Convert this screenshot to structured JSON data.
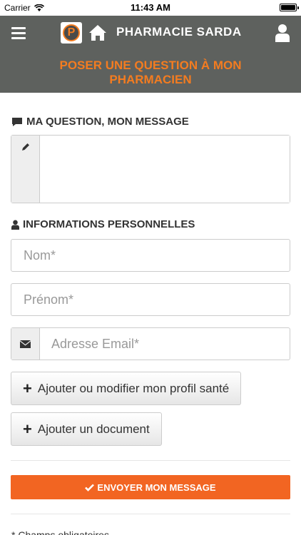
{
  "status_bar": {
    "carrier": "Carrier",
    "time": "11:43 AM",
    "battery_level": 1.0
  },
  "header": {
    "logo_letter": "P",
    "title": "PHARMACIE SARDA",
    "subtitle_line1": "POSER UNE QUESTION À MON",
    "subtitle_line2": "PHARMACIEN"
  },
  "message_section": {
    "title": "MA QUESTION, MON MESSAGE",
    "icon": "comment-icon",
    "edit_icon": "pencil-icon",
    "value": ""
  },
  "personal_section": {
    "title": "INFORMATIONS PERSONNELLES",
    "icon": "user-icon",
    "nom_placeholder": "Nom*",
    "prenom_placeholder": "Prénom*",
    "email_placeholder": "Adresse Email*",
    "email_icon": "envelope-icon"
  },
  "actions": {
    "profile_button": "Ajouter ou modifier mon profil santé",
    "document_button": "Ajouter un document",
    "send_button": "ENVOYER MON MESSAGE"
  },
  "footer": {
    "partial_text": "* Champs obligatoires"
  },
  "colors": {
    "header_bg": "#5e615e",
    "accent": "#f47c20",
    "primary_button": "#f26522"
  }
}
